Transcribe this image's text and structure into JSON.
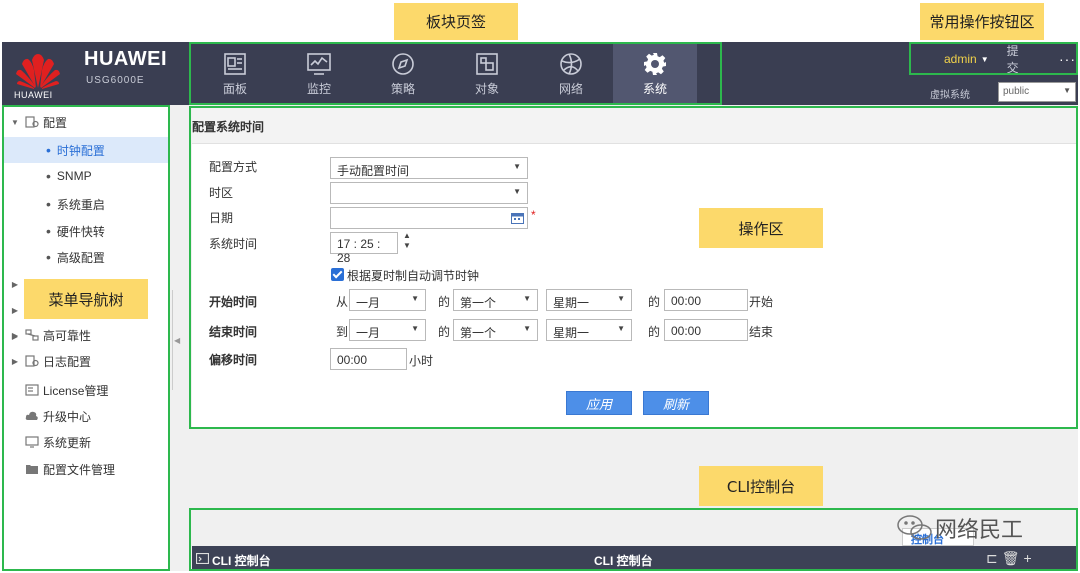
{
  "callouts": {
    "tabs": "板块页签",
    "common_buttons": "常用操作按钮区",
    "operation": "操作区",
    "menu_tree": "菜单导航树",
    "cli": "CLI控制台"
  },
  "brand": {
    "name": "HUAWEI",
    "sub": "HUAWEI",
    "model": "USG6000E"
  },
  "nav_tabs": [
    {
      "label": "面板",
      "icon": "dashboard-icon"
    },
    {
      "label": "监控",
      "icon": "monitor-icon"
    },
    {
      "label": "策略",
      "icon": "compass-icon"
    },
    {
      "label": "对象",
      "icon": "object-icon"
    },
    {
      "label": "网络",
      "icon": "globe-icon"
    },
    {
      "label": "系统",
      "icon": "gear-icon"
    }
  ],
  "user": {
    "name": "admin",
    "submit": "提交",
    "more": "···",
    "vsys_label": "虚拟系统",
    "vsys_value": "public"
  },
  "sidebar": {
    "items": [
      {
        "label": "配置",
        "type": "group",
        "expanded": true
      },
      {
        "label": "时钟配置",
        "type": "sub",
        "active": true
      },
      {
        "label": "SNMP",
        "type": "sub"
      },
      {
        "label": "系统重启",
        "type": "sub"
      },
      {
        "label": "硬件快转",
        "type": "sub"
      },
      {
        "label": "高级配置",
        "type": "sub"
      },
      {
        "label": "高可靠性",
        "type": "group"
      },
      {
        "label": "日志配置",
        "type": "group"
      },
      {
        "label": "License管理",
        "type": "leaf"
      },
      {
        "label": "升级中心",
        "type": "leaf"
      },
      {
        "label": "系统更新",
        "type": "leaf"
      },
      {
        "label": "配置文件管理",
        "type": "leaf"
      }
    ]
  },
  "panel": {
    "title": "配置系统时间",
    "config_mode_label": "配置方式",
    "config_mode_value": "手动配置时间",
    "timezone_label": "时区",
    "timezone_value": "",
    "date_label": "日期",
    "date_value": "",
    "required_mark": "*",
    "systime_label": "系统时间",
    "systime_value": "17 : 25 : 28",
    "dst_label": "根据夏时制自动调节时钟",
    "start_label": "开始时间",
    "start_from": "从",
    "start_month": "一月",
    "of": "的",
    "start_week": "第一个",
    "start_day": "星期一",
    "start_time": "00:00",
    "start_suffix": "开始",
    "end_label": "结束时间",
    "end_to": "到",
    "end_month": "一月",
    "end_week": "第一个",
    "end_day": "星期一",
    "end_time": "00:00",
    "end_suffix": "结束",
    "offset_label": "偏移时间",
    "offset_value": "00:00",
    "offset_unit": "小时",
    "apply": "应用",
    "refresh": "刷新"
  },
  "cli": {
    "title_left": "CLI 控制台",
    "title_mid": "CLI 控制台",
    "tab": "控制台"
  },
  "watermark": "网络民工"
}
